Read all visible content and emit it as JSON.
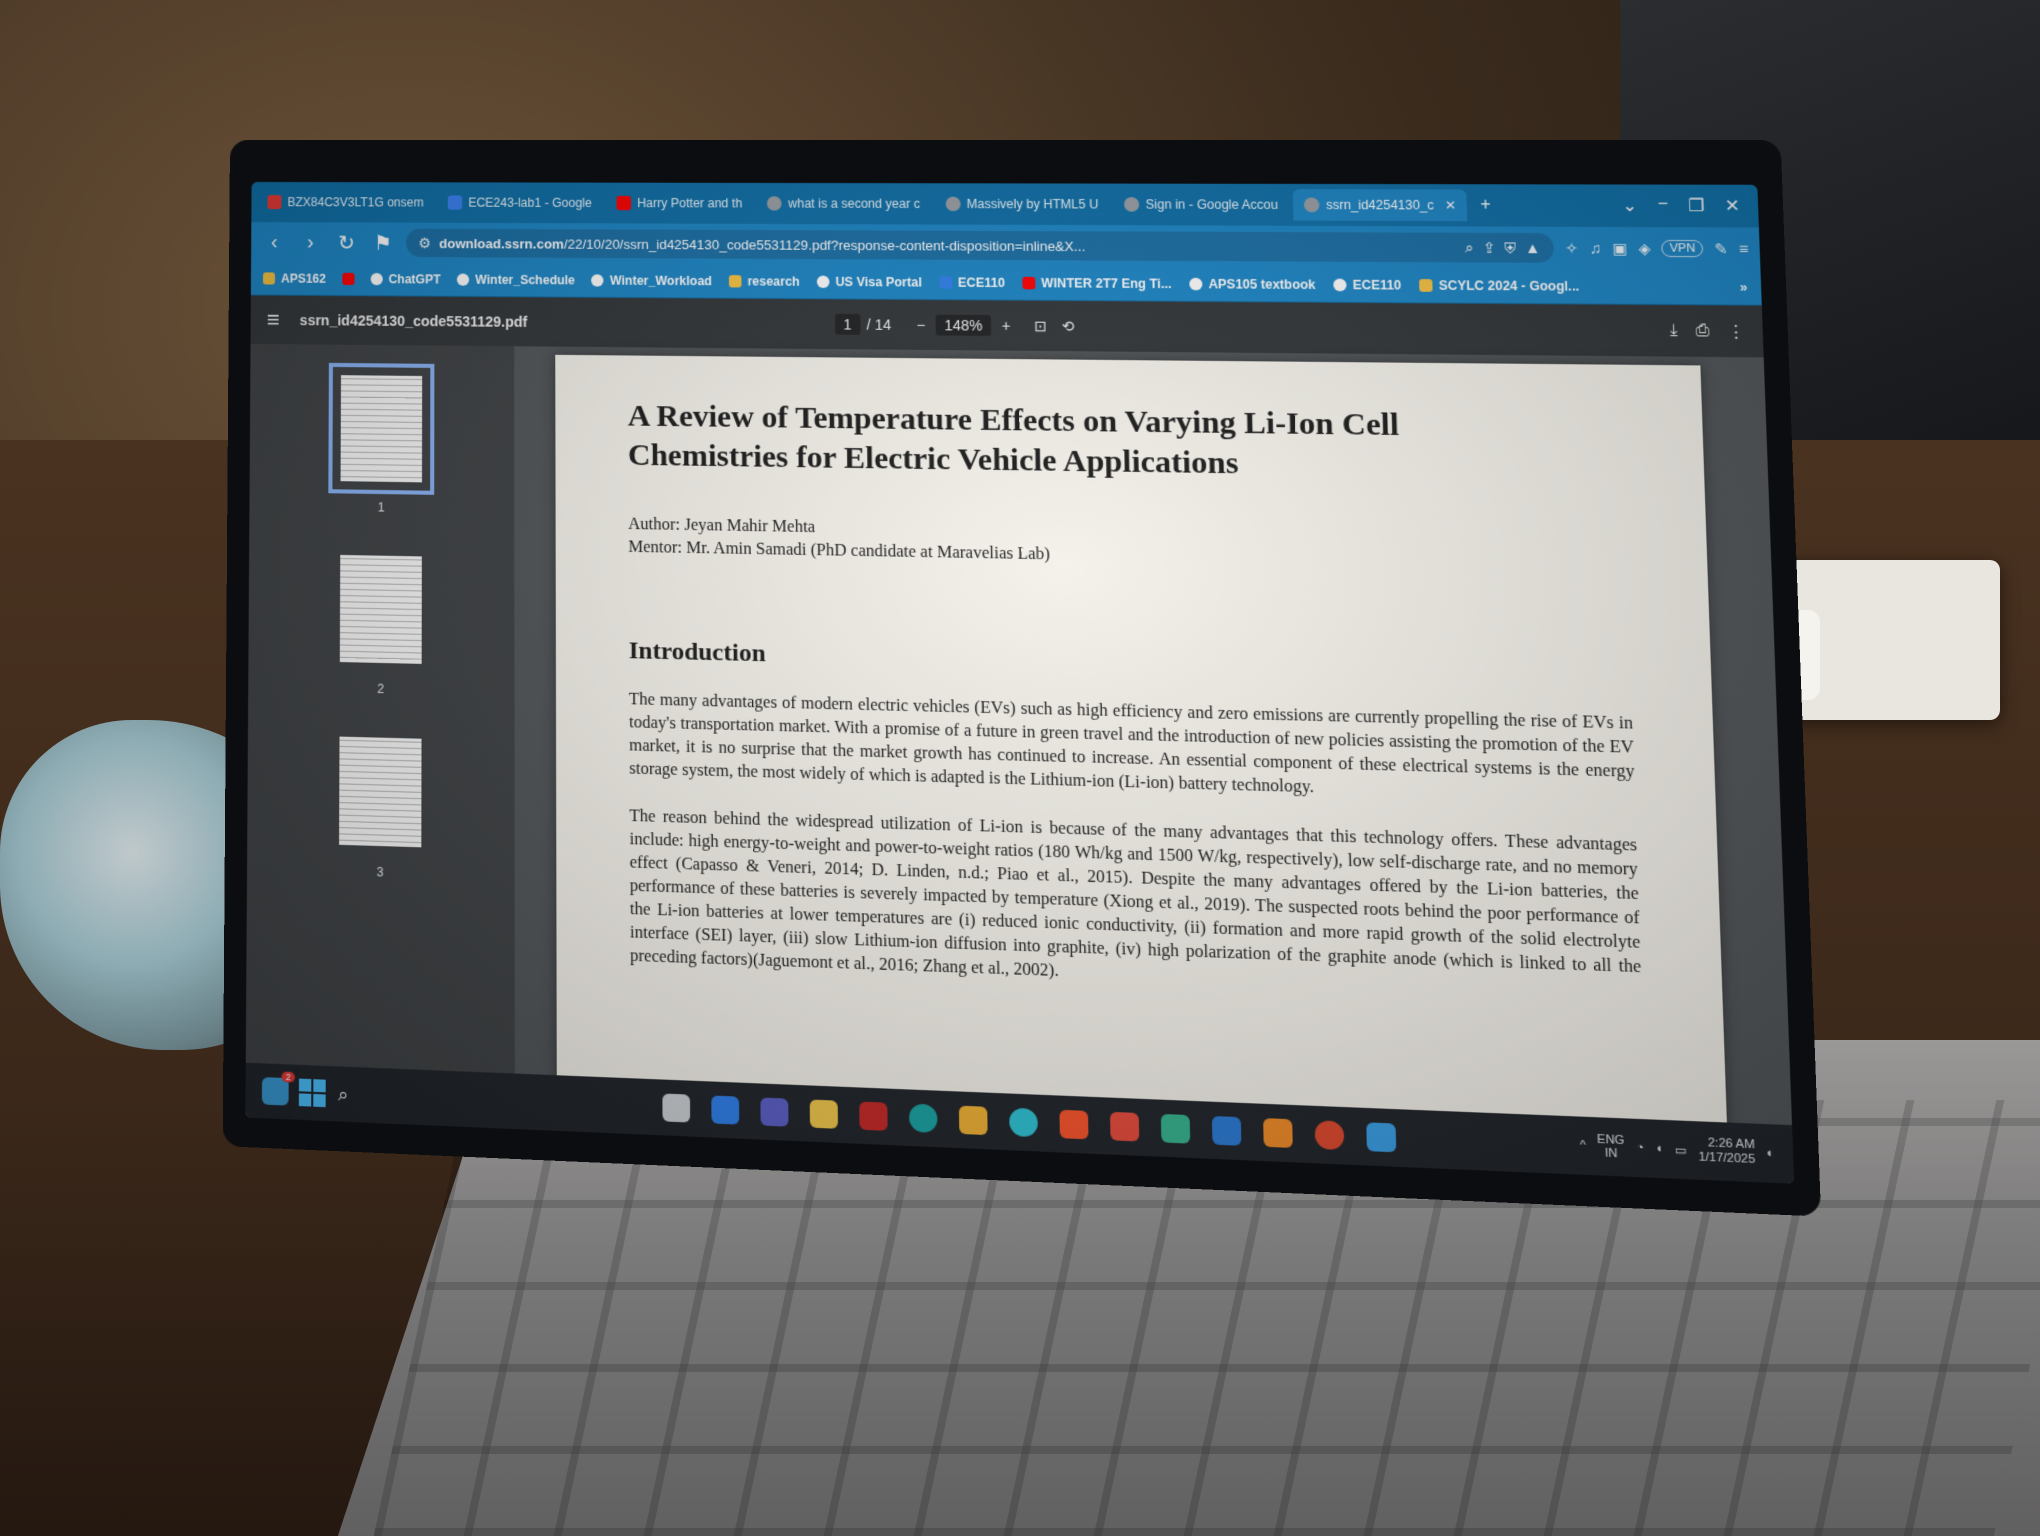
{
  "browser": {
    "tabs": [
      {
        "label": "BZX84C3V3LT1G onsem",
        "icon": "pdf-icon",
        "color": "#e53935"
      },
      {
        "label": "ECE243-lab1 - Google",
        "icon": "docs-icon",
        "color": "#3b82f6"
      },
      {
        "label": "Harry Potter and th",
        "icon": "youtube-icon",
        "color": "#ff0000"
      },
      {
        "label": "what is a second year c",
        "icon": "google-icon",
        "color": "#9aa0a6"
      },
      {
        "label": "Massively by HTML5 U",
        "icon": "web-icon",
        "color": "#9aa0a6"
      },
      {
        "label": "Sign in - Google Accou",
        "icon": "google-icon",
        "color": "#9aa0a6"
      },
      {
        "label": "ssrn_id4254130_c",
        "icon": "web-icon",
        "color": "#9aa0a6",
        "active": true
      }
    ],
    "url": {
      "host": "download.ssrn.com",
      "path": "/22/10/20/ssrn_id4254130_code5531129.pdf?response-content-disposition=inline&X..."
    },
    "vpn_label": "VPN",
    "bookmarks": [
      {
        "label": "APS162",
        "icon": "folder-icon"
      },
      {
        "label": "",
        "icon": "youtube-icon"
      },
      {
        "label": "ChatGPT",
        "icon": "chatgpt-icon"
      },
      {
        "label": "Winter_Schedule",
        "icon": "web-icon"
      },
      {
        "label": "Winter_Workload",
        "icon": "web-icon"
      },
      {
        "label": "research",
        "icon": "folder-icon"
      },
      {
        "label": "US Visa Portal",
        "icon": "link-icon"
      },
      {
        "label": "ECE110",
        "icon": "web-icon"
      },
      {
        "label": "WINTER 2T7 Eng Ti...",
        "icon": "web-icon"
      },
      {
        "label": "APS105 textbook",
        "icon": "web-icon"
      },
      {
        "label": "ECE110",
        "icon": "web-icon"
      },
      {
        "label": "SCYLC 2024 - Googl...",
        "icon": "web-icon"
      }
    ],
    "colors": {
      "accent": "#1c86c6",
      "tabbar": "#0e6fa8"
    }
  },
  "pdf": {
    "filename": "ssrn_id4254130_code5531129.pdf",
    "page_current": "1",
    "page_total": "/ 14",
    "zoom": "148%",
    "thumbnails": [
      "1",
      "2",
      "3"
    ]
  },
  "paper": {
    "title": "A Review of Temperature Effects on Varying Li-Ion Cell Chemistries for Electric Vehicle Applications",
    "author": "Author: Jeyan Mahir Mehta",
    "mentor": "Mentor: Mr. Amin Samadi (PhD candidate at Maravelias Lab)",
    "section_heading": "Introduction",
    "paragraph_1": "The many advantages of modern electric vehicles (EVs) such as high efficiency and zero emissions are currently propelling the rise of EVs in today's transportation market. With a promise of a future in green travel and the introduction of new policies assisting the promotion of the EV market, it is no surprise that the market growth has continued to increase. An essential component of these electrical systems is the energy storage system, the most widely of which is adapted is the Lithium-ion (Li-ion) battery technology.",
    "paragraph_2": "The reason behind the widespread utilization of Li-ion is because of the many advantages that this technology offers. These advantages include: high energy-to-weight and power-to-weight ratios (180 Wh/kg and 1500 W/kg, respectively), low self-discharge rate, and no memory effect (Capasso & Veneri, 2014; D. Linden, n.d.; Piao et al., 2015). Despite the many advantages offered by the Li-ion batteries, the performance of these batteries is severely impacted by temperature (Xiong et al., 2019). The suspected roots behind the poor performance of the Li-ion batteries at lower temperatures are (i) reduced ionic conductivity, (ii) formation and more rapid growth of the solid electrolyte interface (SEI) layer, (iii) slow Lithium-ion diffusion into graphite, (iv) high polarization of the graphite anode (which is linked to all the preceding factors)(Jaguemont et al., 2016; Zhang et al., 2002)."
  },
  "taskbar": {
    "lang": "ENG",
    "region": "IN",
    "time": "2:26 AM",
    "date": "1/17/2025",
    "badge": "2"
  }
}
